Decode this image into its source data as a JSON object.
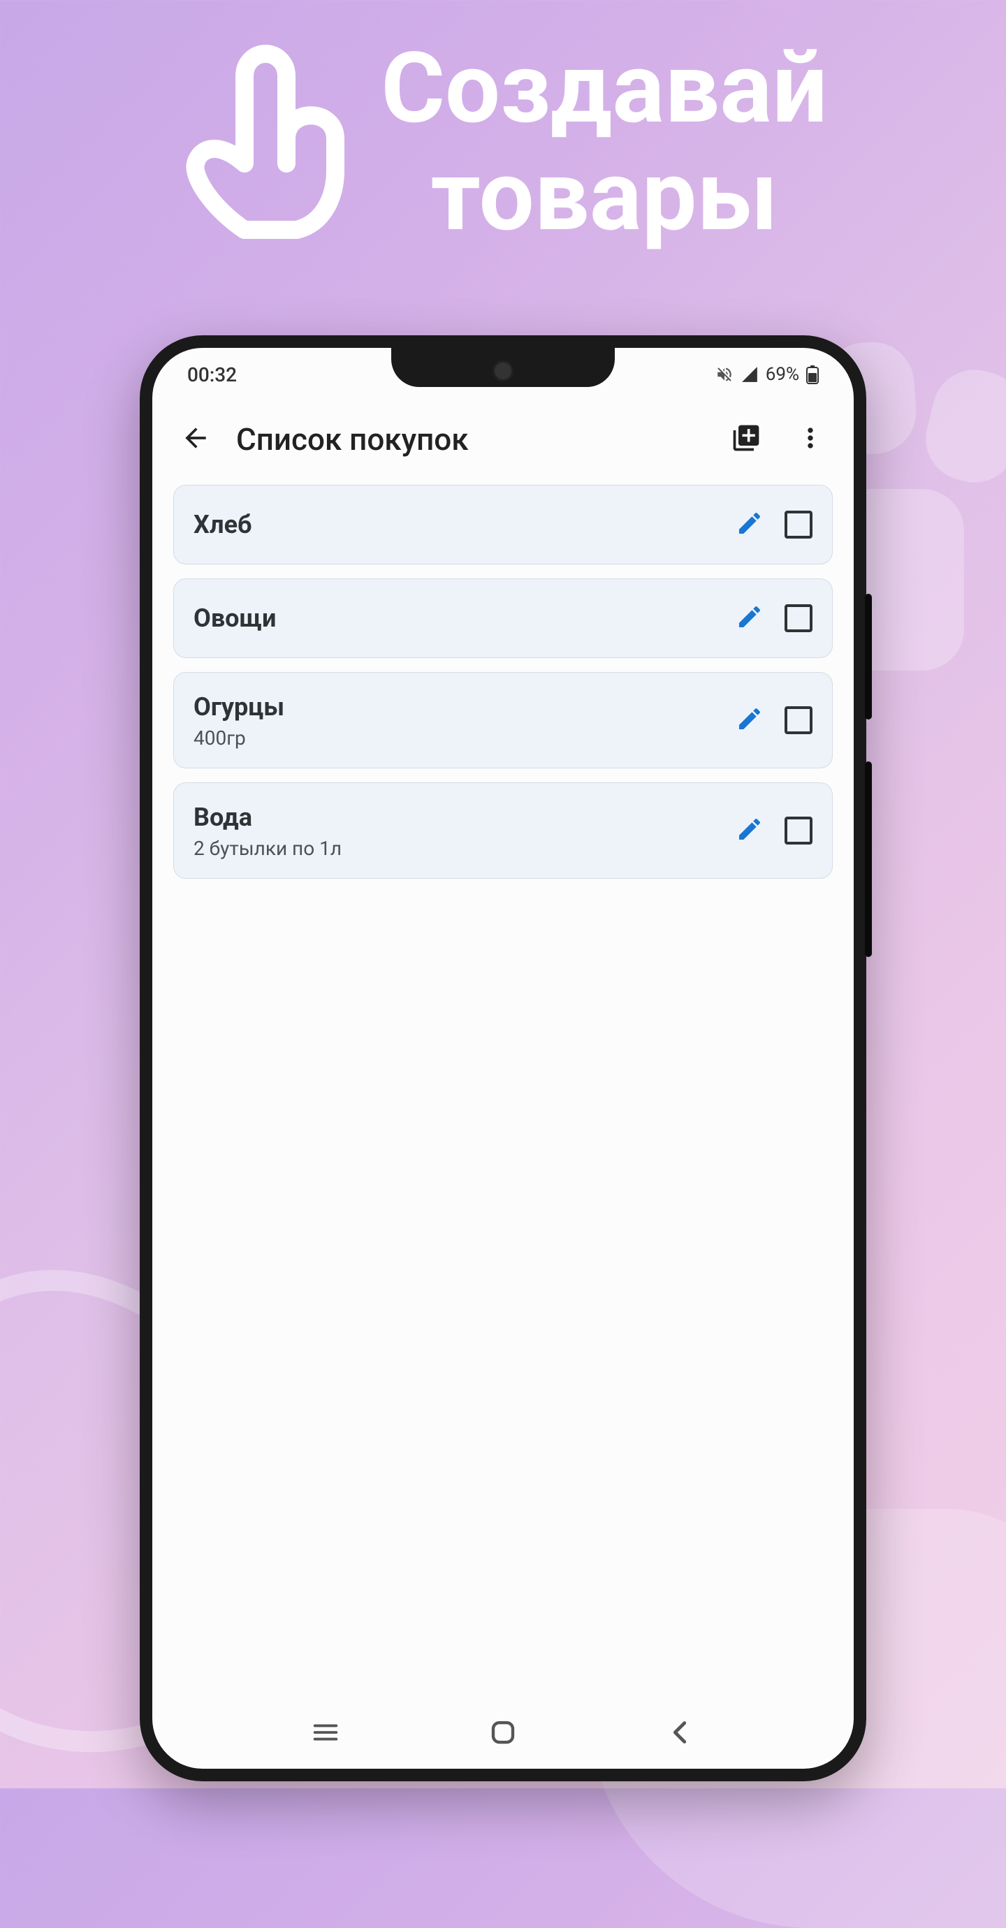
{
  "promo": {
    "headline_line1": "Создавай",
    "headline_line2": "товары"
  },
  "status": {
    "time": "00:32",
    "battery": "69%"
  },
  "app": {
    "title": "Список покупок"
  },
  "items": [
    {
      "title": "Хлеб",
      "subtitle": ""
    },
    {
      "title": "Овощи",
      "subtitle": ""
    },
    {
      "title": "Огурцы",
      "subtitle": "400гр"
    },
    {
      "title": "Вода",
      "subtitle": "2 бутылки по 1л"
    }
  ]
}
